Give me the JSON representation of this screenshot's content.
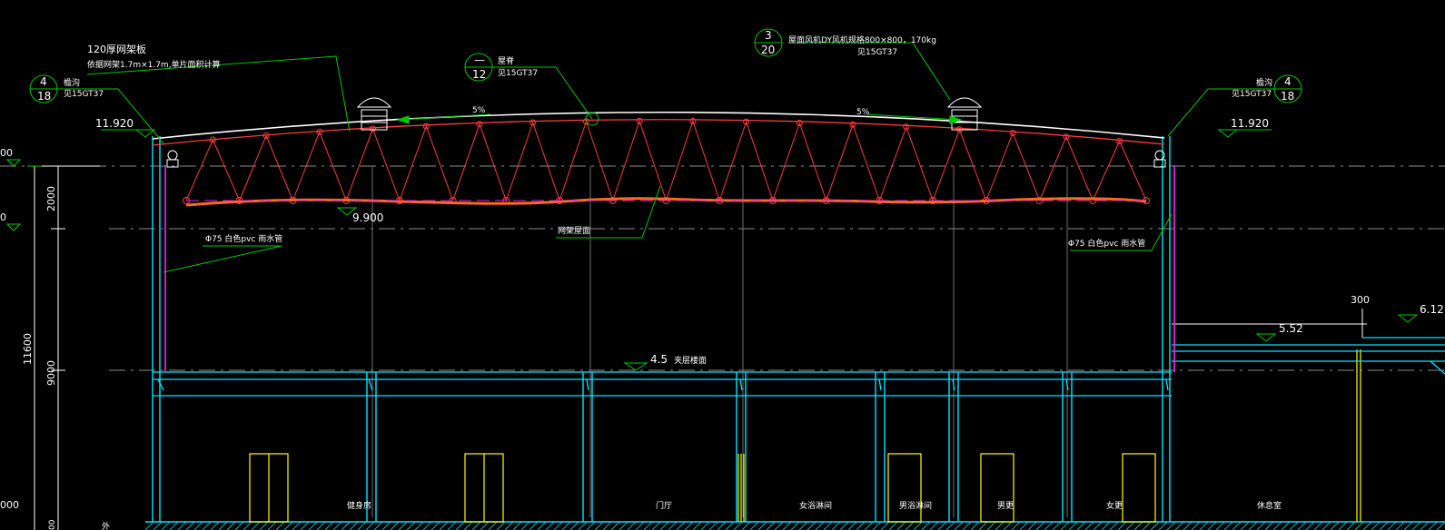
{
  "colors": {
    "background": "#000000",
    "text": "#ffffff",
    "leader": "#00c800",
    "column": "#00e5ff",
    "truss": "#ff3b3b",
    "beam": "#ff6a1a",
    "drain": "#e020e0",
    "door": "#ffff00",
    "grid": "#9a9a9a"
  },
  "notes": {
    "roof_panel_line1": "120厚网架板",
    "roof_panel_line2": "依据网架1.7m×1.7m,单片面积计算",
    "ventilator_text": "屋面风机DY风机规格800×800，170kg",
    "ventilator_ref": "见15GT37",
    "ridge_label": "屋脊",
    "ridge_ref": "见15GT37",
    "gutter_left_label": "檐沟",
    "gutter_left_ref": "见15GT37",
    "gutter_right_label": "檐沟",
    "gutter_right_ref": "见15GT37",
    "downpipe_left": "Φ75 白色pvc 雨水管",
    "downpipe_right": "Φ75 白色pvc 雨水管",
    "grid_roof": "网架屋面",
    "floor_label": "夹层楼面",
    "slope_left": "5%",
    "slope_right": "5%"
  },
  "bubbles": {
    "gutter_left": {
      "top": "4",
      "bottom": "18"
    },
    "ridge": {
      "top": "—",
      "bottom": "12"
    },
    "ventilator": {
      "top": "3",
      "bottom": "20"
    },
    "gutter_right": {
      "top": "4",
      "bottom": "18"
    }
  },
  "elevations": {
    "eave_left": "11.920",
    "eave_right": "11.920",
    "truss_bottom": "9.900",
    "mezzanine": "4.5",
    "canopy": "5.52",
    "parapet": "6.12",
    "dim_300": "300"
  },
  "dimensions": {
    "d_2000": "2000",
    "d_9000": "9000",
    "d_11600": "11600",
    "left_cut_1": "00",
    "left_cut_2": "0",
    "left_cut_3": "000",
    "left_cut_4": "00",
    "left_cut_5": "外"
  },
  "rooms": [
    "健身房",
    "门厅",
    "女浴淋间",
    "男浴淋间",
    "男更",
    "女更",
    "休息室"
  ]
}
